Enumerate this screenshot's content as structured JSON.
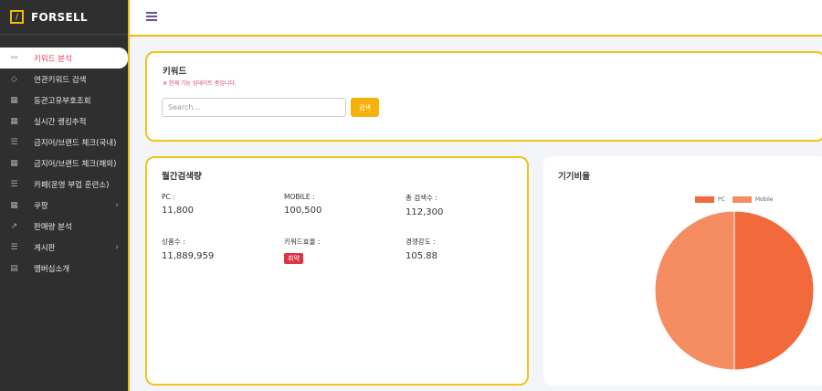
{
  "brand": {
    "logo_glyph": "/",
    "name": "FORSELL"
  },
  "sidebar": {
    "items": [
      {
        "label": "키워드 분석",
        "icon": "link-icon",
        "glyph": "⚯"
      },
      {
        "label": "연관키워드 검색",
        "icon": "tag-icon",
        "glyph": "◇"
      },
      {
        "label": "동관고유부호조회",
        "icon": "grid-icon",
        "glyph": "▦"
      },
      {
        "label": "실시간 랭킹추적",
        "icon": "grid-icon",
        "glyph": "▦"
      },
      {
        "label": "금지어/브랜드 체크(국내)",
        "icon": "list-icon",
        "glyph": "☰"
      },
      {
        "label": "금지어/브랜드 체크(해외)",
        "icon": "grid-icon",
        "glyph": "▦"
      },
      {
        "label": "카페(운영 부업 훈련소)",
        "icon": "list-icon",
        "glyph": "☰"
      },
      {
        "label": "쿠팡",
        "icon": "grid-icon",
        "glyph": "▦",
        "chevron": "›"
      },
      {
        "label": "판매량 분석",
        "icon": "chart-icon",
        "glyph": "↗"
      },
      {
        "label": "게시판",
        "icon": "list-icon",
        "glyph": "☰",
        "chevron": "›"
      },
      {
        "label": "멤버십소개",
        "icon": "document-icon",
        "glyph": "▤"
      }
    ]
  },
  "keyword": {
    "title": "키워드",
    "notice": "※ 현재 기능 업데이트 중입니다.",
    "search_placeholder": "Search...",
    "search_button": "검색"
  },
  "monthly": {
    "title": "월간검색량",
    "pc_label": "PC :",
    "pc_value": "11,800",
    "mobile_label": "MOBILE :",
    "mobile_value": "100,500",
    "total_label": "총 검색수 :",
    "total_value": "112,300",
    "products_label": "상품수 :",
    "products_value": "11,889,959",
    "efficiency_label": "키워드효율 :",
    "efficiency_value": "취약",
    "competition_label": "경쟁강도 :",
    "competition_value": "105.88"
  },
  "device": {
    "title": "기기비율",
    "legend": [
      "PC",
      "Mobile"
    ],
    "colors": {
      "pc": "#f26a3b",
      "mobile": "#f58c62"
    },
    "pc_share": 0.5
  },
  "colors": {
    "accent": "#f0b90b",
    "sidebar_bg": "#2f2f2f",
    "active_text": "#e0405a",
    "badge": "#dc3545",
    "button": "#f5b20a"
  }
}
